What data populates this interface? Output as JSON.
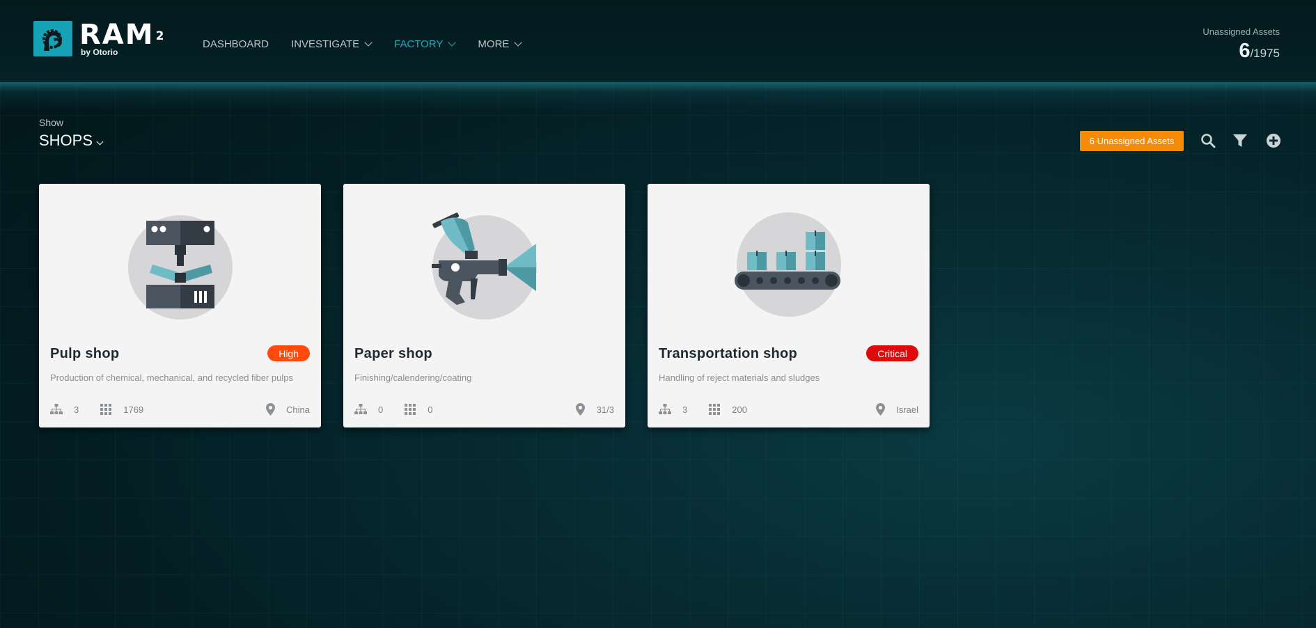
{
  "header": {
    "logo": {
      "name": "RAM",
      "superscript": "2",
      "byline": "by Otorio"
    },
    "nav": [
      {
        "label": "DASHBOARD",
        "has_dropdown": false,
        "active": false
      },
      {
        "label": "INVESTIGATE",
        "has_dropdown": true,
        "active": false
      },
      {
        "label": "FACTORY",
        "has_dropdown": true,
        "active": true
      },
      {
        "label": "MORE",
        "has_dropdown": true,
        "active": false
      }
    ],
    "unassigned": {
      "label": "Unassigned Assets",
      "count": "6",
      "total": "/1975"
    }
  },
  "toolbar": {
    "show_label": "Show",
    "show_value": "SHOPS",
    "unassigned_button": "6 Unassigned Assets",
    "icons": [
      "search-icon",
      "filter-icon",
      "add-icon"
    ]
  },
  "colors": {
    "accent": "#22aebf",
    "orange": "#f58a07",
    "badge_high": "#ff4a0d",
    "badge_critical": "#dd0b0b"
  },
  "cards": [
    {
      "title": "Pulp shop",
      "badge": "High",
      "badge_color": "#ff4a0d",
      "description": "Production of chemical, mechanical, and recycled fiber pulps",
      "hierarchy_count": "3",
      "assets_count": "1769",
      "location": "China",
      "art": "press-machine-icon"
    },
    {
      "title": "Paper shop",
      "badge": "",
      "badge_color": "",
      "description": "Finishing/calendering/coating",
      "hierarchy_count": "0",
      "assets_count": "0",
      "location": "31/3",
      "art": "spray-gun-icon"
    },
    {
      "title": "Transportation shop",
      "badge": "Critical",
      "badge_color": "#dd0b0b",
      "description": "Handling of reject materials and sludges",
      "hierarchy_count": "3",
      "assets_count": "200",
      "location": "Israel",
      "art": "conveyor-icon"
    }
  ]
}
